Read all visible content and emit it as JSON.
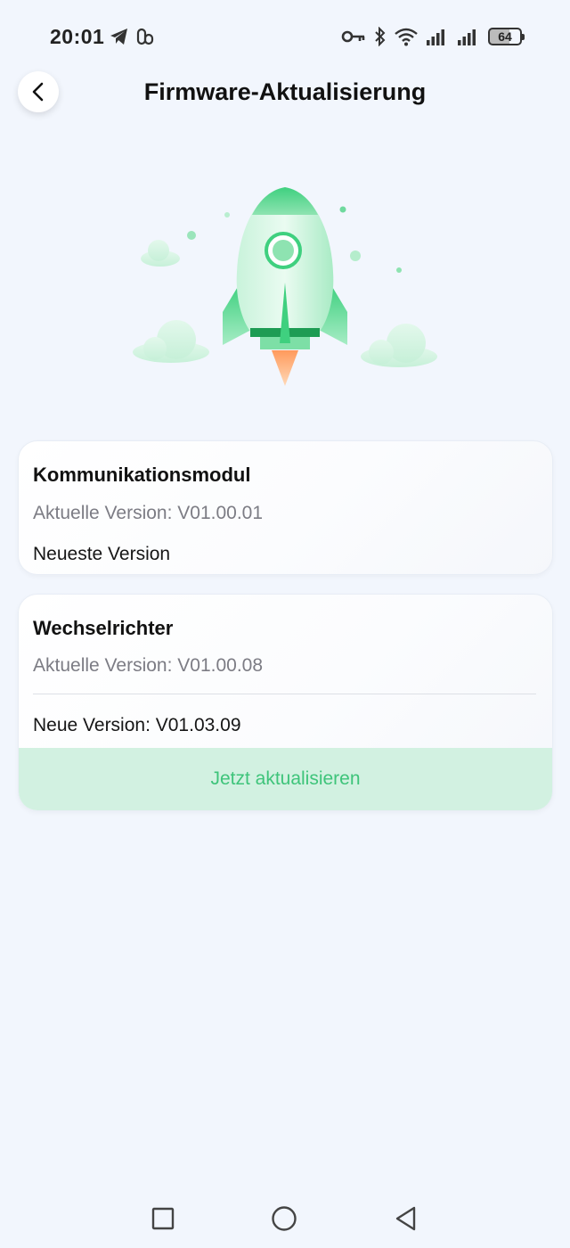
{
  "status_bar": {
    "time": "20:01",
    "battery_level": "64",
    "left_icons": [
      "telegram-icon",
      "app-icon"
    ],
    "right_icons": [
      "vpn-key-icon",
      "bluetooth-icon",
      "wifi-icon",
      "signal-icon",
      "signal-icon",
      "battery-icon"
    ]
  },
  "header": {
    "title": "Firmware-Aktualisierung",
    "back_icon": "chevron-left-icon"
  },
  "hero": {
    "illustration": "rocket-illustration",
    "accent_color": "#3fd07f"
  },
  "modules": [
    {
      "name": "Kommunikationsmodul",
      "current_version": "Aktuelle Version: V01.00.01",
      "status": "Neueste Version"
    },
    {
      "name": "Wechselrichter",
      "current_version": "Aktuelle Version: V01.00.08",
      "new_version": "Neue Version: V01.03.09",
      "action_label": "Jetzt aktualisieren"
    }
  ],
  "nav": {
    "recents_icon": "square-icon",
    "home_icon": "circle-icon",
    "back_icon": "triangle-back-icon"
  },
  "colors": {
    "background": "#f2f6fd",
    "accent_green": "#3ec47a",
    "button_bg": "#d2f1e1"
  }
}
